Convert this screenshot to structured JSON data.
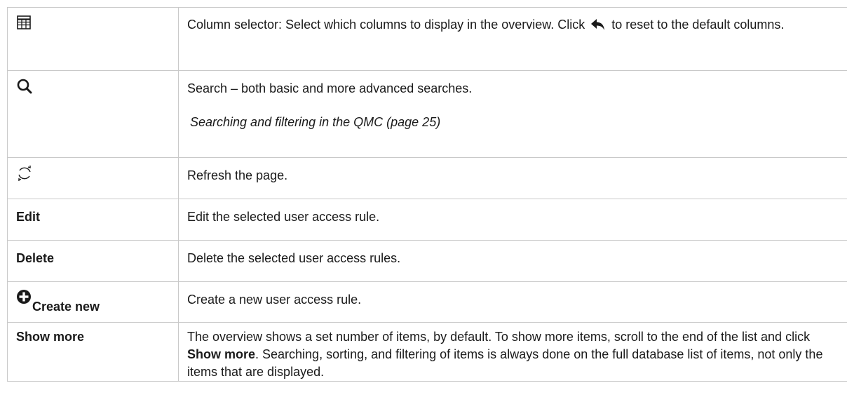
{
  "rows": [
    {
      "icon": "column-selector-icon",
      "description_pre": "Column selector: Select which columns to display in the overview. Click",
      "description_icon": "reset-arrow-icon",
      "description_post": "to reset to the default columns."
    },
    {
      "icon": "search-icon",
      "description": "Search – both basic and more advanced searches.",
      "link": "Searching and filtering in the QMC (page 25)"
    },
    {
      "icon": "refresh-icon",
      "description": "Refresh the page."
    },
    {
      "label": "Edit",
      "description": "Edit the selected user access rule."
    },
    {
      "label": "Delete",
      "description": "Delete the selected user access rules."
    },
    {
      "icon": "plus-circle-icon",
      "label": "Create new",
      "description": "Create a new user access rule."
    },
    {
      "label": "Show more",
      "description_1": "The overview shows a set number of items, by default. To show more items, scroll to the end of the list and click",
      "description_bold": "Show more",
      "description_2": ". Searching, sorting, and filtering of items is always done on the full database list of items, not only the items that are displayed."
    }
  ]
}
